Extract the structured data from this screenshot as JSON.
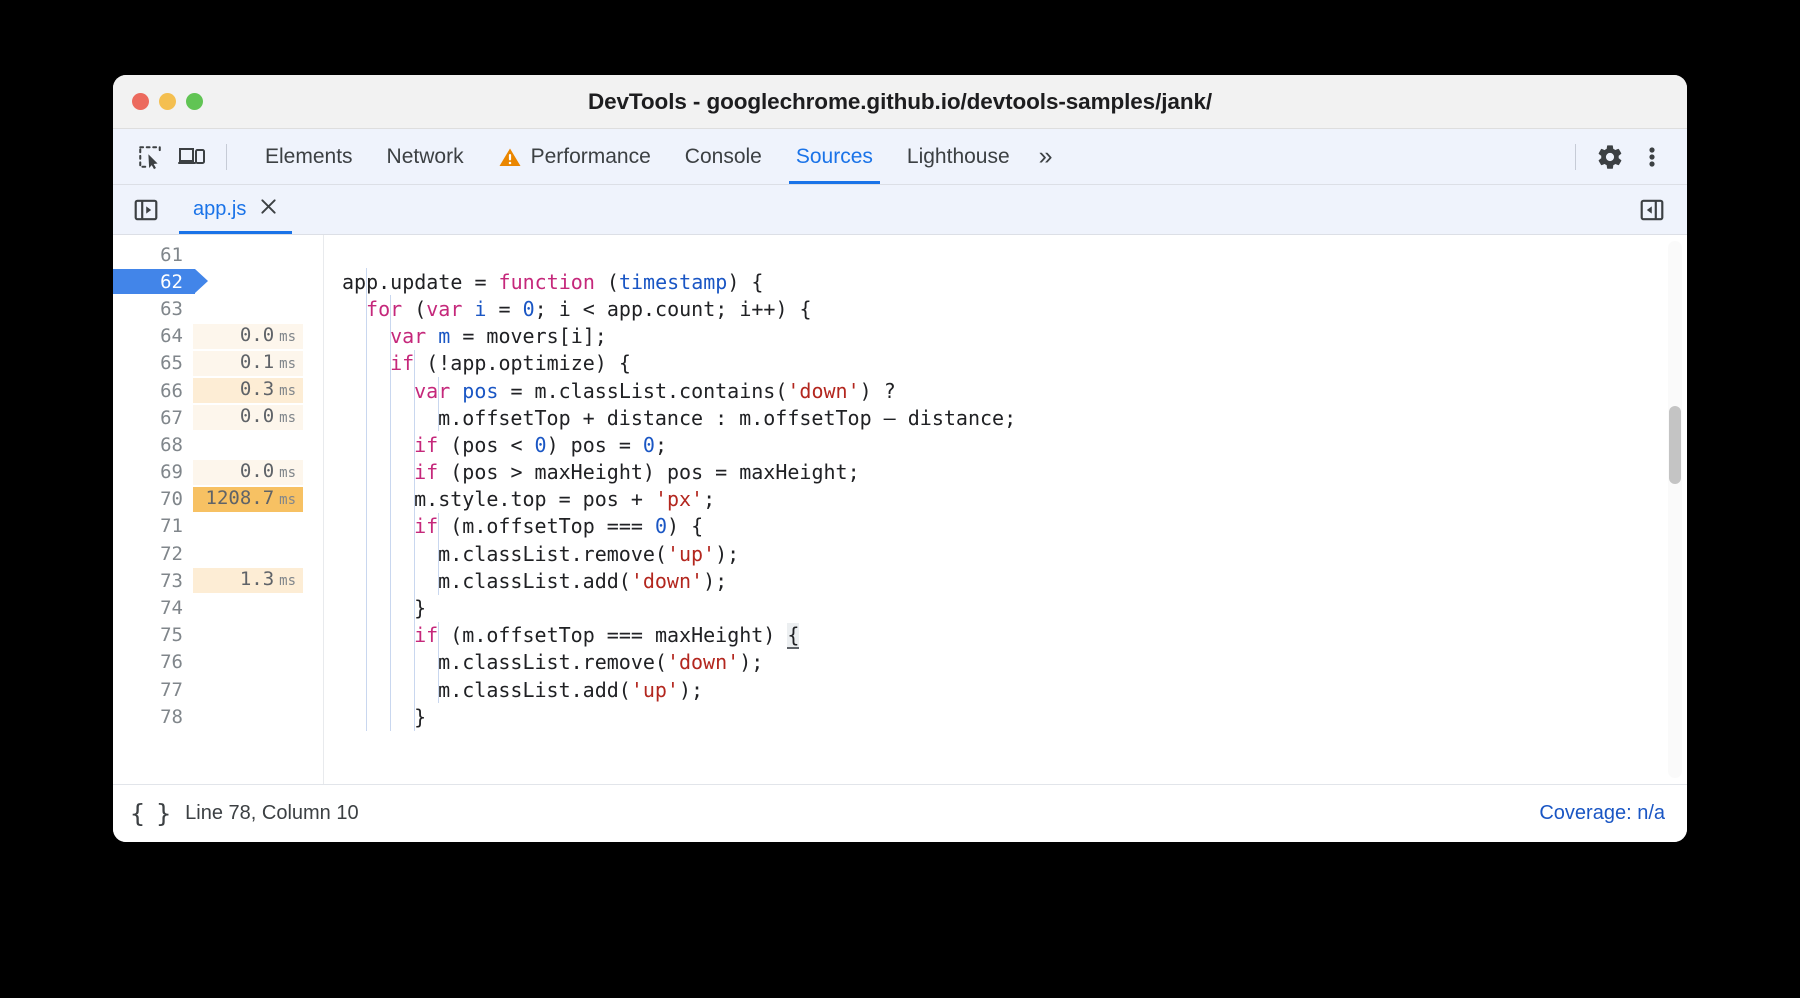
{
  "window": {
    "title": "DevTools - googlechrome.github.io/devtools-samples/jank/",
    "traffic_lights": [
      {
        "name": "close",
        "color": "#ec6a5e"
      },
      {
        "name": "minimize",
        "color": "#f4bf50"
      },
      {
        "name": "zoom",
        "color": "#61c454"
      }
    ]
  },
  "toolbar": {
    "inspect_icon": "inspect-element-icon",
    "device_icon": "device-toolbar-icon",
    "settings_icon": "gear-icon",
    "more_icon": "more-options-icon",
    "overflow_label": "»",
    "tabs": [
      {
        "label": "Elements",
        "active": false,
        "warning": false
      },
      {
        "label": "Network",
        "active": false,
        "warning": false
      },
      {
        "label": "Performance",
        "active": false,
        "warning": true
      },
      {
        "label": "Console",
        "active": false,
        "warning": false
      },
      {
        "label": "Sources",
        "active": true,
        "warning": false
      },
      {
        "label": "Lighthouse",
        "active": false,
        "warning": false
      }
    ]
  },
  "file_strip": {
    "navigator_icon": "show-navigator-icon",
    "debugger_icon": "show-debugger-icon",
    "file_tab": {
      "label": "app.js",
      "close_icon": "close-icon"
    }
  },
  "editor": {
    "lines": [
      {
        "n": "61",
        "perf": "",
        "unit": "",
        "hl": "none",
        "current": false,
        "indent": 0
      },
      {
        "n": "62",
        "perf": "",
        "unit": "",
        "hl": "none",
        "current": true,
        "indent": 0
      },
      {
        "n": "63",
        "perf": "",
        "unit": "",
        "hl": "none",
        "current": false,
        "indent": 1
      },
      {
        "n": "64",
        "perf": "0.0",
        "unit": "ms",
        "hl": "faint",
        "current": false,
        "indent": 2
      },
      {
        "n": "65",
        "perf": "0.1",
        "unit": "ms",
        "hl": "faint",
        "current": false,
        "indent": 2
      },
      {
        "n": "66",
        "perf": "0.3",
        "unit": "ms",
        "hl": "light",
        "current": false,
        "indent": 3
      },
      {
        "n": "67",
        "perf": "0.0",
        "unit": "ms",
        "hl": "faint",
        "current": false,
        "indent": 4
      },
      {
        "n": "68",
        "perf": "",
        "unit": "",
        "hl": "none",
        "current": false,
        "indent": 3
      },
      {
        "n": "69",
        "perf": "0.0",
        "unit": "ms",
        "hl": "faint",
        "current": false,
        "indent": 3
      },
      {
        "n": "70",
        "perf": "1208.7",
        "unit": "ms",
        "hl": "strong",
        "current": false,
        "indent": 3
      },
      {
        "n": "71",
        "perf": "",
        "unit": "",
        "hl": "none",
        "current": false,
        "indent": 3
      },
      {
        "n": "72",
        "perf": "",
        "unit": "",
        "hl": "none",
        "current": false,
        "indent": 4
      },
      {
        "n": "73",
        "perf": "1.3",
        "unit": "ms",
        "hl": "light",
        "current": false,
        "indent": 4
      },
      {
        "n": "74",
        "perf": "",
        "unit": "",
        "hl": "none",
        "current": false,
        "indent": 3
      },
      {
        "n": "75",
        "perf": "",
        "unit": "",
        "hl": "none",
        "current": false,
        "indent": 3
      },
      {
        "n": "76",
        "perf": "",
        "unit": "",
        "hl": "none",
        "current": false,
        "indent": 4
      },
      {
        "n": "77",
        "perf": "",
        "unit": "",
        "hl": "none",
        "current": false,
        "indent": 4
      },
      {
        "n": "78",
        "perf": "",
        "unit": "",
        "hl": "none",
        "current": false,
        "indent": 3
      }
    ],
    "code": [
      {
        "indent": 0,
        "tokens": []
      },
      {
        "indent": 0,
        "tokens": [
          {
            "t": "app.update = ",
            "c": ""
          },
          {
            "t": "function",
            "c": "kw"
          },
          {
            "t": " (",
            "c": ""
          },
          {
            "t": "timestamp",
            "c": "par"
          },
          {
            "t": ") {",
            "c": ""
          }
        ]
      },
      {
        "indent": 2,
        "tokens": [
          {
            "t": "for",
            "c": "kw"
          },
          {
            "t": " (",
            "c": ""
          },
          {
            "t": "var",
            "c": "kw"
          },
          {
            "t": " ",
            "c": ""
          },
          {
            "t": "i",
            "c": "par"
          },
          {
            "t": " = ",
            "c": ""
          },
          {
            "t": "0",
            "c": "num"
          },
          {
            "t": "; i < app.count; i++) {",
            "c": ""
          }
        ]
      },
      {
        "indent": 4,
        "tokens": [
          {
            "t": "var",
            "c": "kw"
          },
          {
            "t": " ",
            "c": ""
          },
          {
            "t": "m",
            "c": "par"
          },
          {
            "t": " = movers[i];",
            "c": ""
          }
        ]
      },
      {
        "indent": 4,
        "tokens": [
          {
            "t": "if",
            "c": "kw"
          },
          {
            "t": " (!app.optimize) {",
            "c": ""
          }
        ]
      },
      {
        "indent": 6,
        "tokens": [
          {
            "t": "var",
            "c": "kw"
          },
          {
            "t": " ",
            "c": ""
          },
          {
            "t": "pos",
            "c": "par"
          },
          {
            "t": " = m.classList.contains(",
            "c": ""
          },
          {
            "t": "'down'",
            "c": "str"
          },
          {
            "t": ") ?",
            "c": ""
          }
        ]
      },
      {
        "indent": 8,
        "tokens": [
          {
            "t": "m.offsetTop + distance : m.offsetTop – distance;",
            "c": ""
          }
        ]
      },
      {
        "indent": 6,
        "tokens": [
          {
            "t": "if",
            "c": "kw"
          },
          {
            "t": " (pos < ",
            "c": ""
          },
          {
            "t": "0",
            "c": "num"
          },
          {
            "t": ") pos = ",
            "c": ""
          },
          {
            "t": "0",
            "c": "num"
          },
          {
            "t": ";",
            "c": ""
          }
        ]
      },
      {
        "indent": 6,
        "tokens": [
          {
            "t": "if",
            "c": "kw"
          },
          {
            "t": " (pos > maxHeight) pos = maxHeight;",
            "c": ""
          }
        ]
      },
      {
        "indent": 6,
        "tokens": [
          {
            "t": "m.style.top = pos + ",
            "c": ""
          },
          {
            "t": "'px'",
            "c": "str"
          },
          {
            "t": ";",
            "c": ""
          }
        ]
      },
      {
        "indent": 6,
        "tokens": [
          {
            "t": "if",
            "c": "kw"
          },
          {
            "t": " (m.offsetTop === ",
            "c": ""
          },
          {
            "t": "0",
            "c": "num"
          },
          {
            "t": ") {",
            "c": ""
          }
        ]
      },
      {
        "indent": 8,
        "tokens": [
          {
            "t": "m.classList.remove(",
            "c": ""
          },
          {
            "t": "'up'",
            "c": "str"
          },
          {
            "t": ");",
            "c": ""
          }
        ]
      },
      {
        "indent": 8,
        "tokens": [
          {
            "t": "m.classList.add(",
            "c": ""
          },
          {
            "t": "'down'",
            "c": "str"
          },
          {
            "t": ");",
            "c": ""
          }
        ]
      },
      {
        "indent": 6,
        "tokens": [
          {
            "t": "}",
            "c": ""
          }
        ]
      },
      {
        "indent": 6,
        "tokens": [
          {
            "t": "if",
            "c": "kw"
          },
          {
            "t": " (m.offsetTop === maxHeight) ",
            "c": ""
          },
          {
            "t": "{",
            "c": "brace-hl"
          }
        ]
      },
      {
        "indent": 8,
        "tokens": [
          {
            "t": "m.classList.remove(",
            "c": ""
          },
          {
            "t": "'down'",
            "c": "str"
          },
          {
            "t": ");",
            "c": ""
          }
        ]
      },
      {
        "indent": 8,
        "tokens": [
          {
            "t": "m.classList.add(",
            "c": ""
          },
          {
            "t": "'up'",
            "c": "str"
          },
          {
            "t": ");",
            "c": ""
          }
        ]
      },
      {
        "indent": 6,
        "tokens": [
          {
            "t": "}",
            "c": ""
          }
        ]
      }
    ],
    "scrollbar": {
      "name": "vertical-scrollbar"
    }
  },
  "status": {
    "pretty_print_icon": "{ }",
    "line_column": "Line 78, Column 10",
    "coverage": "Coverage: n/a"
  },
  "colors": {
    "accent": "#1a73e8",
    "breakpoint": "#4285e9",
    "perf_strong": "#f7c163",
    "perf_light": "#fdedd5",
    "perf_faint": "#fdf6ec",
    "keyword": "#c5287b",
    "string": "#b3261e",
    "number": "#1a56c4",
    "warning": "#ea8600"
  }
}
